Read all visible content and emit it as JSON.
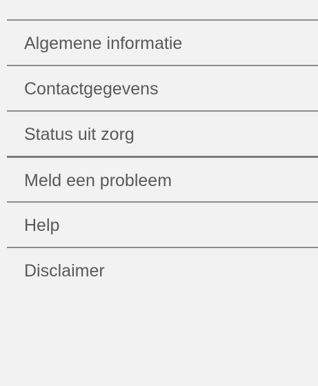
{
  "menu": {
    "items": [
      {
        "label": "Algemene informatie"
      },
      {
        "label": "Contactgegevens"
      },
      {
        "label": "Status uit zorg"
      },
      {
        "label": "Meld een probleem"
      },
      {
        "label": "Help"
      },
      {
        "label": "Disclaimer"
      }
    ]
  }
}
